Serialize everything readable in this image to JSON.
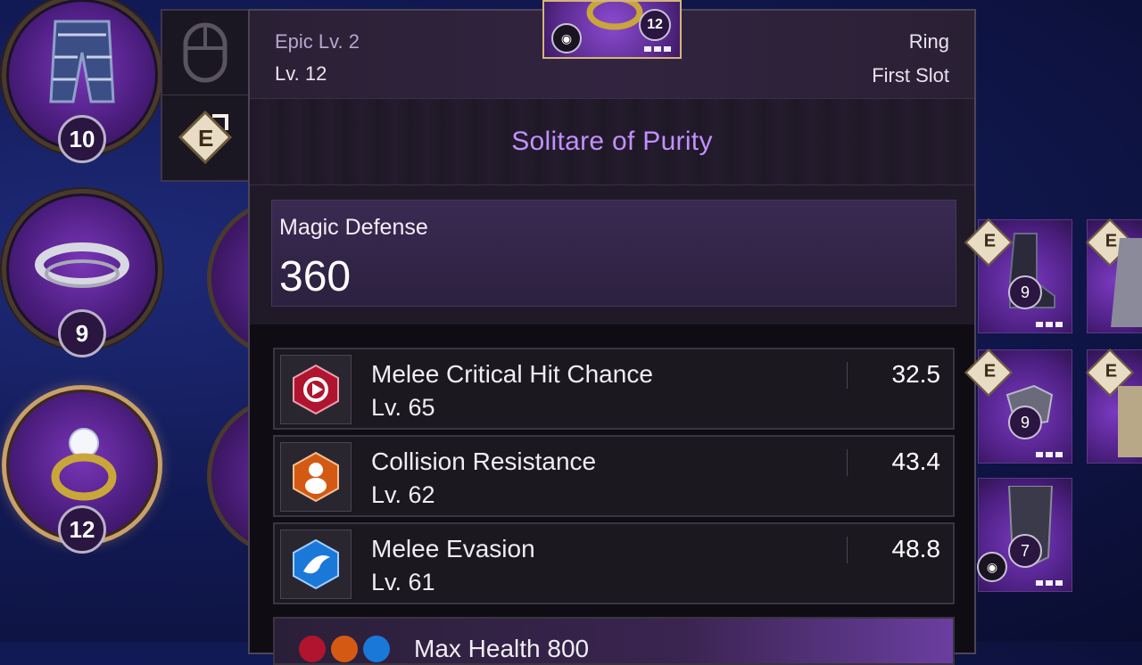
{
  "left_slots": [
    {
      "icon": "pants-icon",
      "level": "10"
    },
    {
      "icon": "bracelet-icon",
      "level": "9"
    },
    {
      "icon": "ring-icon",
      "level": "12",
      "selected": true
    }
  ],
  "side_buttons": [
    {
      "icon": "mouse-icon"
    },
    {
      "icon": "equip-icon",
      "letter": "E"
    }
  ],
  "top_icon": {
    "level": "12",
    "icon": "ring-icon"
  },
  "tooltip": {
    "grade": "Epic Lv. 2",
    "level": "Lv. 12",
    "item_type": "Ring",
    "slot": "First Slot",
    "item_name": "Solitare of Purity",
    "main_stat": {
      "label": "Magic Defense",
      "value": "360"
    },
    "sub_stats": [
      {
        "name": "Melee Critical Hit Chance",
        "level": "Lv. 65",
        "value": "32.5",
        "icon": "critical-hit-icon",
        "color": "#b0142e"
      },
      {
        "name": "Collision Resistance",
        "level": "Lv. 62",
        "value": "43.4",
        "icon": "collision-resistance-icon",
        "color": "#d45a14"
      },
      {
        "name": "Melee Evasion",
        "level": "Lv. 61",
        "value": "48.8",
        "icon": "evasion-icon",
        "color": "#1a78d8"
      }
    ],
    "next_row_text": "Max Health 800"
  },
  "inventory_tiles": [
    {
      "level": "9",
      "badge": "E"
    },
    {
      "level": "",
      "badge": "E"
    },
    {
      "level": "9",
      "badge": "E"
    },
    {
      "level": "",
      "badge": "E"
    },
    {
      "level": "7",
      "badge": ""
    }
  ]
}
